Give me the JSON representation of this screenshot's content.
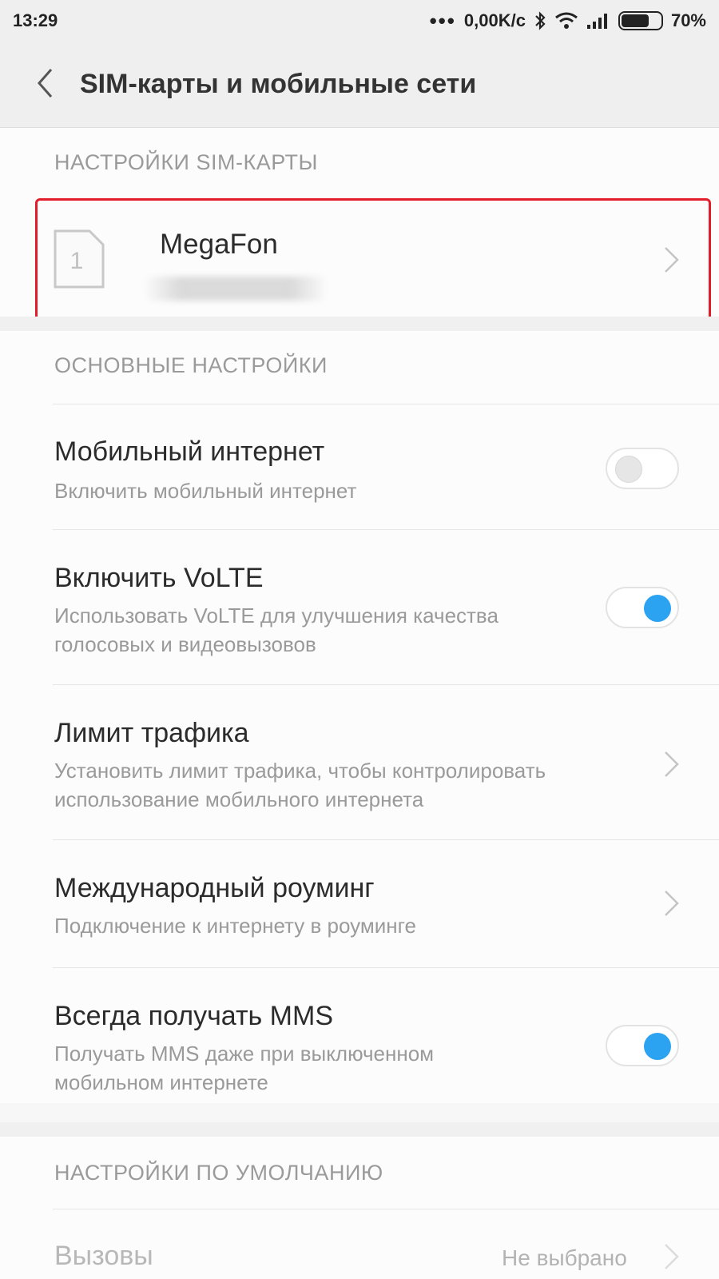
{
  "status_bar": {
    "time": "13:29",
    "dots": "•••",
    "speed": "0,00K/c",
    "battery": "70%",
    "battery_level": 0.7
  },
  "app_bar": {
    "title": "SIM-карты и мобильные сети",
    "back_icon": "chevron-left-icon"
  },
  "sim_section": {
    "header": "НАСТРОЙКИ SIM-КАРТЫ",
    "sim_slot": "1",
    "carrier": "MegaFon"
  },
  "main_section": {
    "header": "ОСНОВНЫЕ НАСТРОЙКИ",
    "items": [
      {
        "title": "Мобильный интернет",
        "subtitle_lines": [
          "Включить мобильный интернет"
        ],
        "control": "toggle",
        "enabled": false
      },
      {
        "title": "Включить VoLTE",
        "subtitle_lines": [
          "Использовать VoLTE для улучшения качества",
          "голосовых и видеовызовов"
        ],
        "control": "toggle",
        "enabled": true
      },
      {
        "title": "Лимит трафика",
        "subtitle_lines": [
          "Установить лимит трафика, чтобы контролировать",
          "использование мобильного интернета"
        ],
        "control": "chevron"
      },
      {
        "title": "Международный роуминг",
        "subtitle_lines": [
          "Подключение к интернету в роуминге"
        ],
        "control": "chevron"
      },
      {
        "title": "Всегда получать MMS",
        "subtitle_lines": [
          "Получать MMS даже при выключенном",
          "мобильном интернете"
        ],
        "control": "toggle",
        "enabled": true
      }
    ]
  },
  "default_section": {
    "header": "НАСТРОЙКИ ПО УМОЛЧАНИЮ",
    "items": [
      {
        "title": "Вызовы",
        "value": "Не выбрано",
        "control": "chevron"
      }
    ]
  },
  "colors": {
    "accent": "#2ba3f1",
    "highlight_border": "#e21c2b",
    "header_text": "#9a9a9a"
  }
}
